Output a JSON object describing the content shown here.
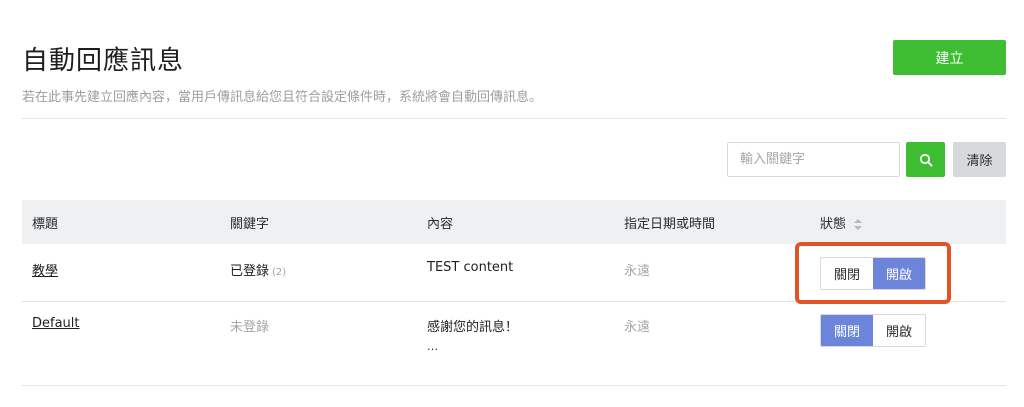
{
  "header": {
    "title": "自動回應訊息",
    "description": "若在此事先建立回應內容，當用戶傳訊息給您且符合設定條件時，系統將會自動回傳訊息。",
    "create_label": "建立"
  },
  "search": {
    "placeholder": "輸入關鍵字",
    "clear_label": "清除"
  },
  "table": {
    "columns": [
      "標題",
      "關鍵字",
      "內容",
      "指定日期或時間",
      "狀態"
    ],
    "rows": [
      {
        "title": "教學",
        "keyword": "已登錄",
        "keyword_count": "(2)",
        "content": "TEST content",
        "content_more": "",
        "schedule": "永遠",
        "off_label": "關閉",
        "on_label": "開啟",
        "state": "on"
      },
      {
        "title": "Default",
        "keyword": "未登錄",
        "keyword_count": "",
        "content": "感謝您的訊息！",
        "content_more": "…",
        "schedule": "永遠",
        "off_label": "關閉",
        "on_label": "開啟",
        "state": "off"
      }
    ]
  },
  "colors": {
    "primary_green": "#3ebd32",
    "toggle_active": "#6c85da",
    "highlight": "#e35425"
  }
}
